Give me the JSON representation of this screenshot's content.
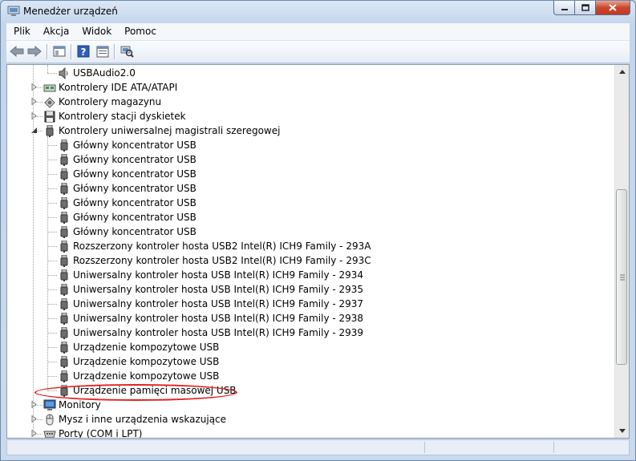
{
  "window": {
    "title": "Menedżer urządzeń"
  },
  "menubar": {
    "items": [
      "Plik",
      "Akcja",
      "Widok",
      "Pomoc"
    ]
  },
  "tree": {
    "rows": [
      {
        "level": 2,
        "label": "USBAudio2.0",
        "icon": "speaker-icon",
        "expander": "none"
      },
      {
        "level": 1,
        "label": "Kontrolery IDE ATA/ATAPI",
        "icon": "ide-controller-icon",
        "expander": "collapsed"
      },
      {
        "level": 1,
        "label": "Kontrolery magazynu",
        "icon": "storage-controller-icon",
        "expander": "collapsed"
      },
      {
        "level": 1,
        "label": "Kontrolery stacji dyskietek",
        "icon": "floppy-controller-icon",
        "expander": "collapsed"
      },
      {
        "level": 1,
        "label": "Kontrolery uniwersalnej magistrali szeregowej",
        "icon": "usb-icon",
        "expander": "expanded"
      },
      {
        "level": 2,
        "label": "Główny koncentrator USB",
        "icon": "usb-icon",
        "expander": "none"
      },
      {
        "level": 2,
        "label": "Główny koncentrator USB",
        "icon": "usb-icon",
        "expander": "none"
      },
      {
        "level": 2,
        "label": "Główny koncentrator USB",
        "icon": "usb-icon",
        "expander": "none"
      },
      {
        "level": 2,
        "label": "Główny koncentrator USB",
        "icon": "usb-icon",
        "expander": "none"
      },
      {
        "level": 2,
        "label": "Główny koncentrator USB",
        "icon": "usb-icon",
        "expander": "none"
      },
      {
        "level": 2,
        "label": "Główny koncentrator USB",
        "icon": "usb-icon",
        "expander": "none"
      },
      {
        "level": 2,
        "label": "Główny koncentrator USB",
        "icon": "usb-icon",
        "expander": "none"
      },
      {
        "level": 2,
        "label": "Rozszerzony kontroler hosta USB2 Intel(R) ICH9 Family - 293A",
        "icon": "usb-icon",
        "expander": "none"
      },
      {
        "level": 2,
        "label": "Rozszerzony kontroler hosta USB2 Intel(R) ICH9 Family - 293C",
        "icon": "usb-icon",
        "expander": "none"
      },
      {
        "level": 2,
        "label": "Uniwersalny kontroler hosta USB Intel(R) ICH9 Family - 2934",
        "icon": "usb-icon",
        "expander": "none"
      },
      {
        "level": 2,
        "label": "Uniwersalny kontroler hosta USB Intel(R) ICH9 Family - 2935",
        "icon": "usb-icon",
        "expander": "none"
      },
      {
        "level": 2,
        "label": "Uniwersalny kontroler hosta USB Intel(R) ICH9 Family - 2937",
        "icon": "usb-icon",
        "expander": "none"
      },
      {
        "level": 2,
        "label": "Uniwersalny kontroler hosta USB Intel(R) ICH9 Family - 2938",
        "icon": "usb-icon",
        "expander": "none"
      },
      {
        "level": 2,
        "label": "Uniwersalny kontroler hosta USB Intel(R) ICH9 Family - 2939",
        "icon": "usb-icon",
        "expander": "none"
      },
      {
        "level": 2,
        "label": "Urządzenie kompozytowe USB",
        "icon": "usb-icon",
        "expander": "none"
      },
      {
        "level": 2,
        "label": "Urządzenie kompozytowe USB",
        "icon": "usb-icon",
        "expander": "none"
      },
      {
        "level": 2,
        "label": "Urządzenie kompozytowe USB",
        "icon": "usb-icon",
        "expander": "none"
      },
      {
        "level": 2,
        "label": "Urządzenie pamięci masowej USB",
        "icon": "usb-icon",
        "expander": "none",
        "highlighted": true
      },
      {
        "level": 1,
        "label": "Monitory",
        "icon": "monitor-icon",
        "expander": "collapsed"
      },
      {
        "level": 1,
        "label": "Mysz i inne urządzenia wskazujące",
        "icon": "mouse-icon",
        "expander": "collapsed"
      },
      {
        "level": 1,
        "label": "Porty (COM i LPT)",
        "icon": "port-icon",
        "expander": "collapsed"
      }
    ]
  },
  "colors": {
    "annotation": "#e32020",
    "window_frame": "#c4d6ec"
  }
}
